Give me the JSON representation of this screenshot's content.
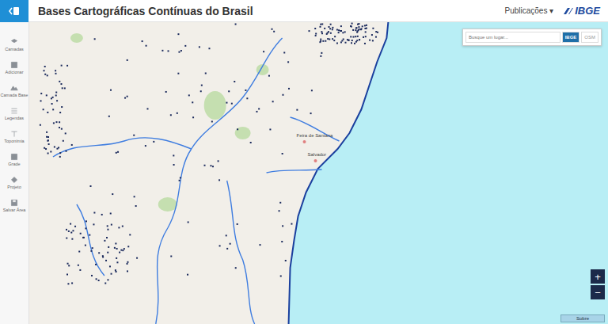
{
  "header": {
    "title": "Bases Cartográficas Contínuas do Brasil",
    "menu": "Publicações",
    "menu_caret": "▾",
    "logo": "IBGE"
  },
  "sidebar": {
    "items": [
      {
        "label": "Camadas"
      },
      {
        "label": "Adicionar"
      },
      {
        "label": "Camada Base"
      },
      {
        "label": "Legendas"
      },
      {
        "label": "Toponímia"
      },
      {
        "label": "Grade"
      },
      {
        "label": "Projeto"
      },
      {
        "label": "Salvar Área"
      }
    ]
  },
  "search": {
    "placeholder": "Busque um lugar...",
    "buttons": [
      {
        "label": "IBGE",
        "selected": true
      },
      {
        "label": "OSM",
        "selected": false
      }
    ]
  },
  "map": {
    "labels": [
      "Feira de Santana",
      "Salvador"
    ]
  },
  "zoom": [
    "+",
    "−"
  ],
  "footer_button": "Sobre"
}
